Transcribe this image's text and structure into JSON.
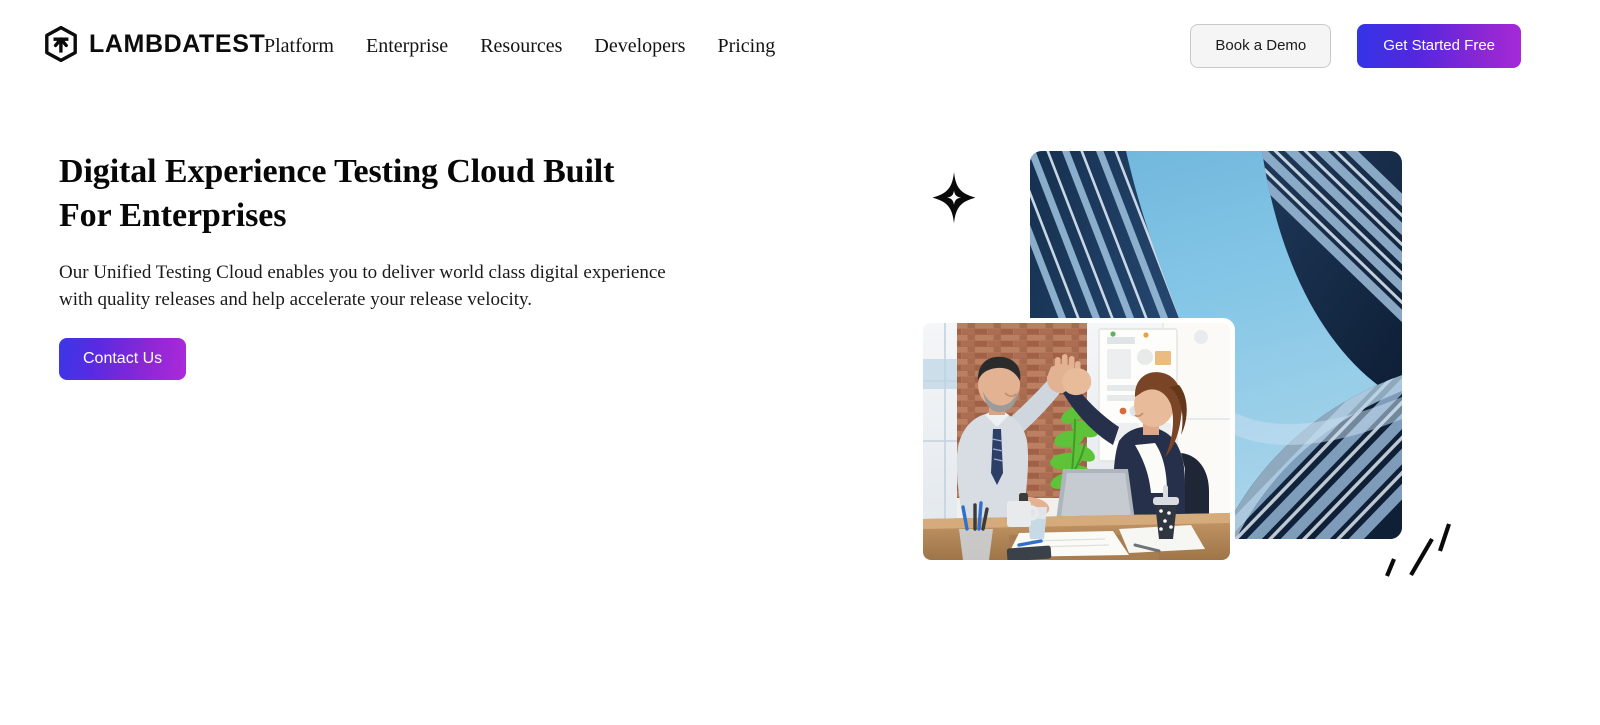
{
  "header": {
    "logo": {
      "icon": "lambdatest-hexagon-arrow-logo",
      "wordmark": "LAMBDATEST"
    },
    "nav": [
      {
        "label": "Platform"
      },
      {
        "label": "Enterprise"
      },
      {
        "label": "Resources"
      },
      {
        "label": "Developers"
      },
      {
        "label": "Pricing"
      }
    ],
    "actions": {
      "demo_label": "Book a Demo",
      "get_started_label": "Get Started Free"
    }
  },
  "hero": {
    "title": "Digital Experience Testing Cloud Built For Enterprises",
    "subtitle": "Our Unified Testing Cloud enables you to deliver world class digital experience with quality releases and help accelerate your release velocity.",
    "cta_label": "Contact Us",
    "decorations": {
      "sparkle_icon": "four-point-sparkle-icon",
      "dashes_icon": "diagonal-dashes-icon"
    },
    "images": {
      "building": {
        "name": "modern-blue-glass-skyscrapers-photo",
        "alt": "Upward view of two curved blue glass office towers against a clear sky"
      },
      "office": {
        "name": "colleagues-high-five-office-photo",
        "alt": "Businessman and businesswoman high-fiving across a desk with a laptop in a brick-walled office"
      }
    }
  },
  "colors": {
    "gradient_start": "#3434e6",
    "gradient_end": "#a52ad6",
    "text_primary": "#070707",
    "demo_button_bg": "#f5f5f5",
    "demo_button_border": "#c9c9c9",
    "building_sky": "#7cc1e2",
    "building_dark_stripe": "#1e3a5f",
    "building_light_stripe": "#6b9bc9",
    "page_bg": "#ffffff"
  }
}
